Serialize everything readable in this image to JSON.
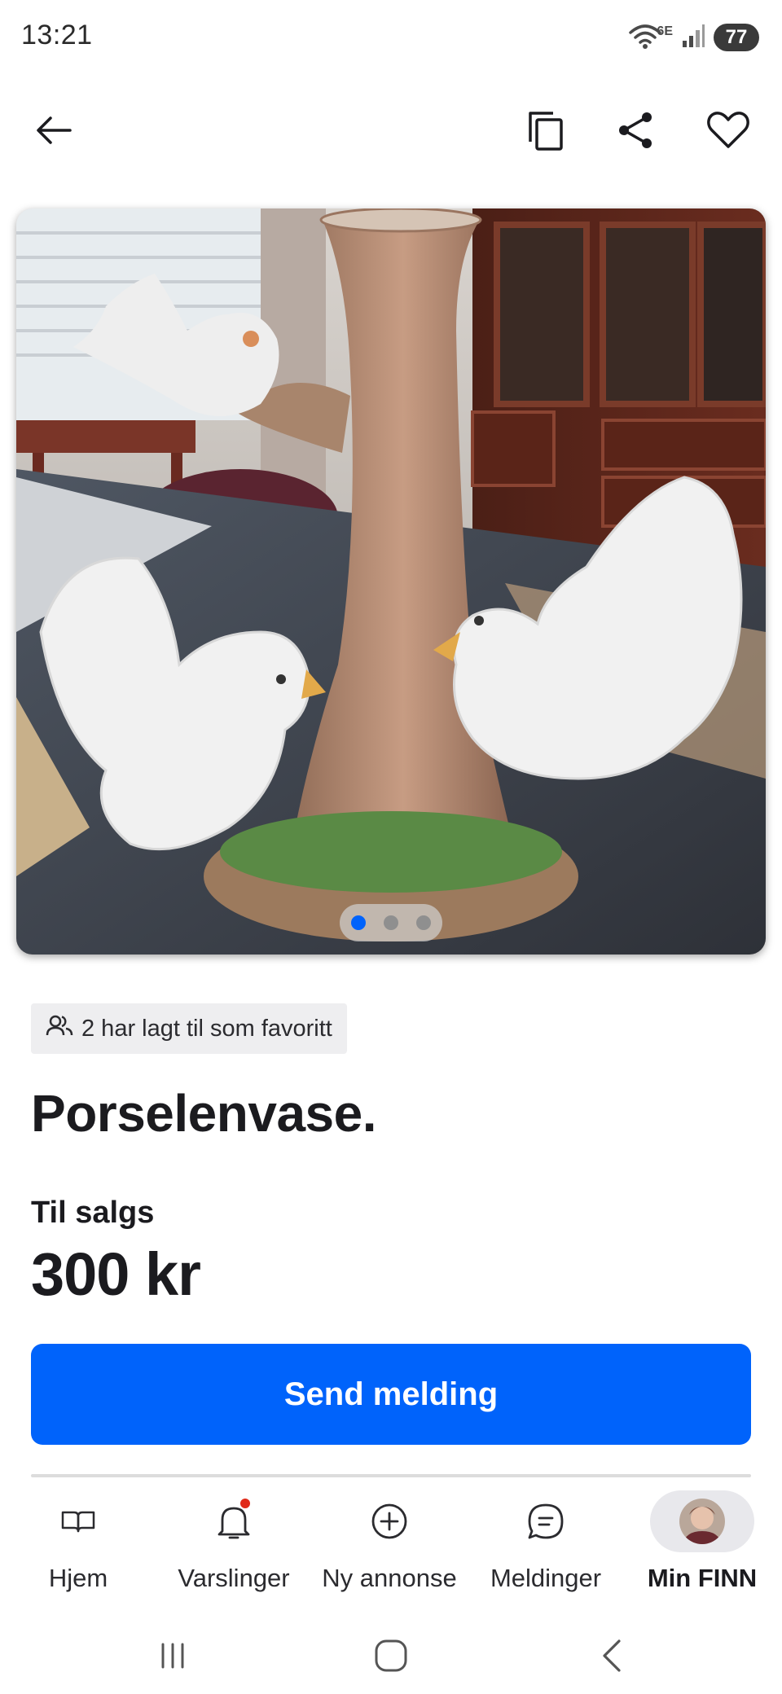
{
  "status_bar": {
    "time": "13:21",
    "network": "6E",
    "battery": "77"
  },
  "toolbar": {
    "icons": [
      "arrow-left-icon",
      "copy-icon",
      "share-icon",
      "heart-icon"
    ]
  },
  "carousel": {
    "image_description_icon": "photo",
    "total_images": 3,
    "active_index": 0
  },
  "listing": {
    "favorites_text": "2 har lagt til som favoritt",
    "title": "Porselenvase.",
    "sale_type": "Til salgs",
    "price": "300 kr",
    "send_button": "Send melding"
  },
  "bottom_nav": {
    "items": [
      {
        "label": "Hjem",
        "icon": "book-icon"
      },
      {
        "label": "Varslinger",
        "icon": "bell-icon"
      },
      {
        "label": "Ny annonse",
        "icon": "plus-circle-icon"
      },
      {
        "label": "Meldinger",
        "icon": "chat-icon"
      },
      {
        "label": "Min FINN",
        "icon": "avatar"
      }
    ]
  },
  "colors": {
    "accent": "#0063fb",
    "notification": "#e02a1a",
    "badge_bg": "#eeeef0"
  }
}
